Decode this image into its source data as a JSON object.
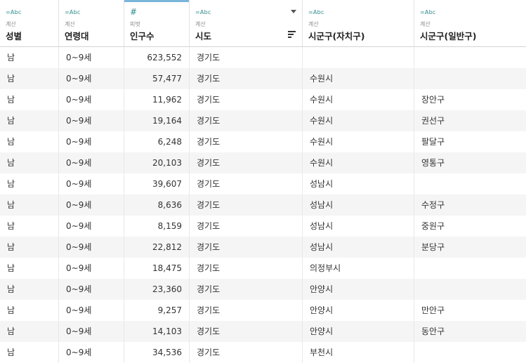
{
  "columns": [
    {
      "type": "=Abc",
      "sub": "계산",
      "name": "성별"
    },
    {
      "type": "=Abc",
      "sub": "계산",
      "name": "연령대"
    },
    {
      "type": "#",
      "sub": "피벗",
      "name": "인구수"
    },
    {
      "type": "=Abc",
      "sub": "계산",
      "name": "시도"
    },
    {
      "type": "=Abc",
      "sub": "계산",
      "name": "시군구(자치구)"
    },
    {
      "type": "=Abc",
      "sub": "계산",
      "name": "시군구(일반구)"
    }
  ],
  "rows": [
    [
      "남",
      "0~9세",
      "623,552",
      "경기도",
      "",
      ""
    ],
    [
      "남",
      "0~9세",
      "57,477",
      "경기도",
      "수원시",
      ""
    ],
    [
      "남",
      "0~9세",
      "11,962",
      "경기도",
      "수원시",
      "장안구"
    ],
    [
      "남",
      "0~9세",
      "19,164",
      "경기도",
      "수원시",
      "권선구"
    ],
    [
      "남",
      "0~9세",
      "6,248",
      "경기도",
      "수원시",
      "팔달구"
    ],
    [
      "남",
      "0~9세",
      "20,103",
      "경기도",
      "수원시",
      "영통구"
    ],
    [
      "남",
      "0~9세",
      "39,607",
      "경기도",
      "성남시",
      ""
    ],
    [
      "남",
      "0~9세",
      "8,636",
      "경기도",
      "성남시",
      "수정구"
    ],
    [
      "남",
      "0~9세",
      "8,159",
      "경기도",
      "성남시",
      "중원구"
    ],
    [
      "남",
      "0~9세",
      "22,812",
      "경기도",
      "성남시",
      "분당구"
    ],
    [
      "남",
      "0~9세",
      "18,475",
      "경기도",
      "의정부시",
      ""
    ],
    [
      "남",
      "0~9세",
      "23,360",
      "경기도",
      "안양시",
      ""
    ],
    [
      "남",
      "0~9세",
      "9,257",
      "경기도",
      "안양시",
      "만안구"
    ],
    [
      "남",
      "0~9세",
      "14,103",
      "경기도",
      "안양시",
      "동안구"
    ],
    [
      "남",
      "0~9세",
      "34,536",
      "경기도",
      "부천시",
      ""
    ]
  ]
}
